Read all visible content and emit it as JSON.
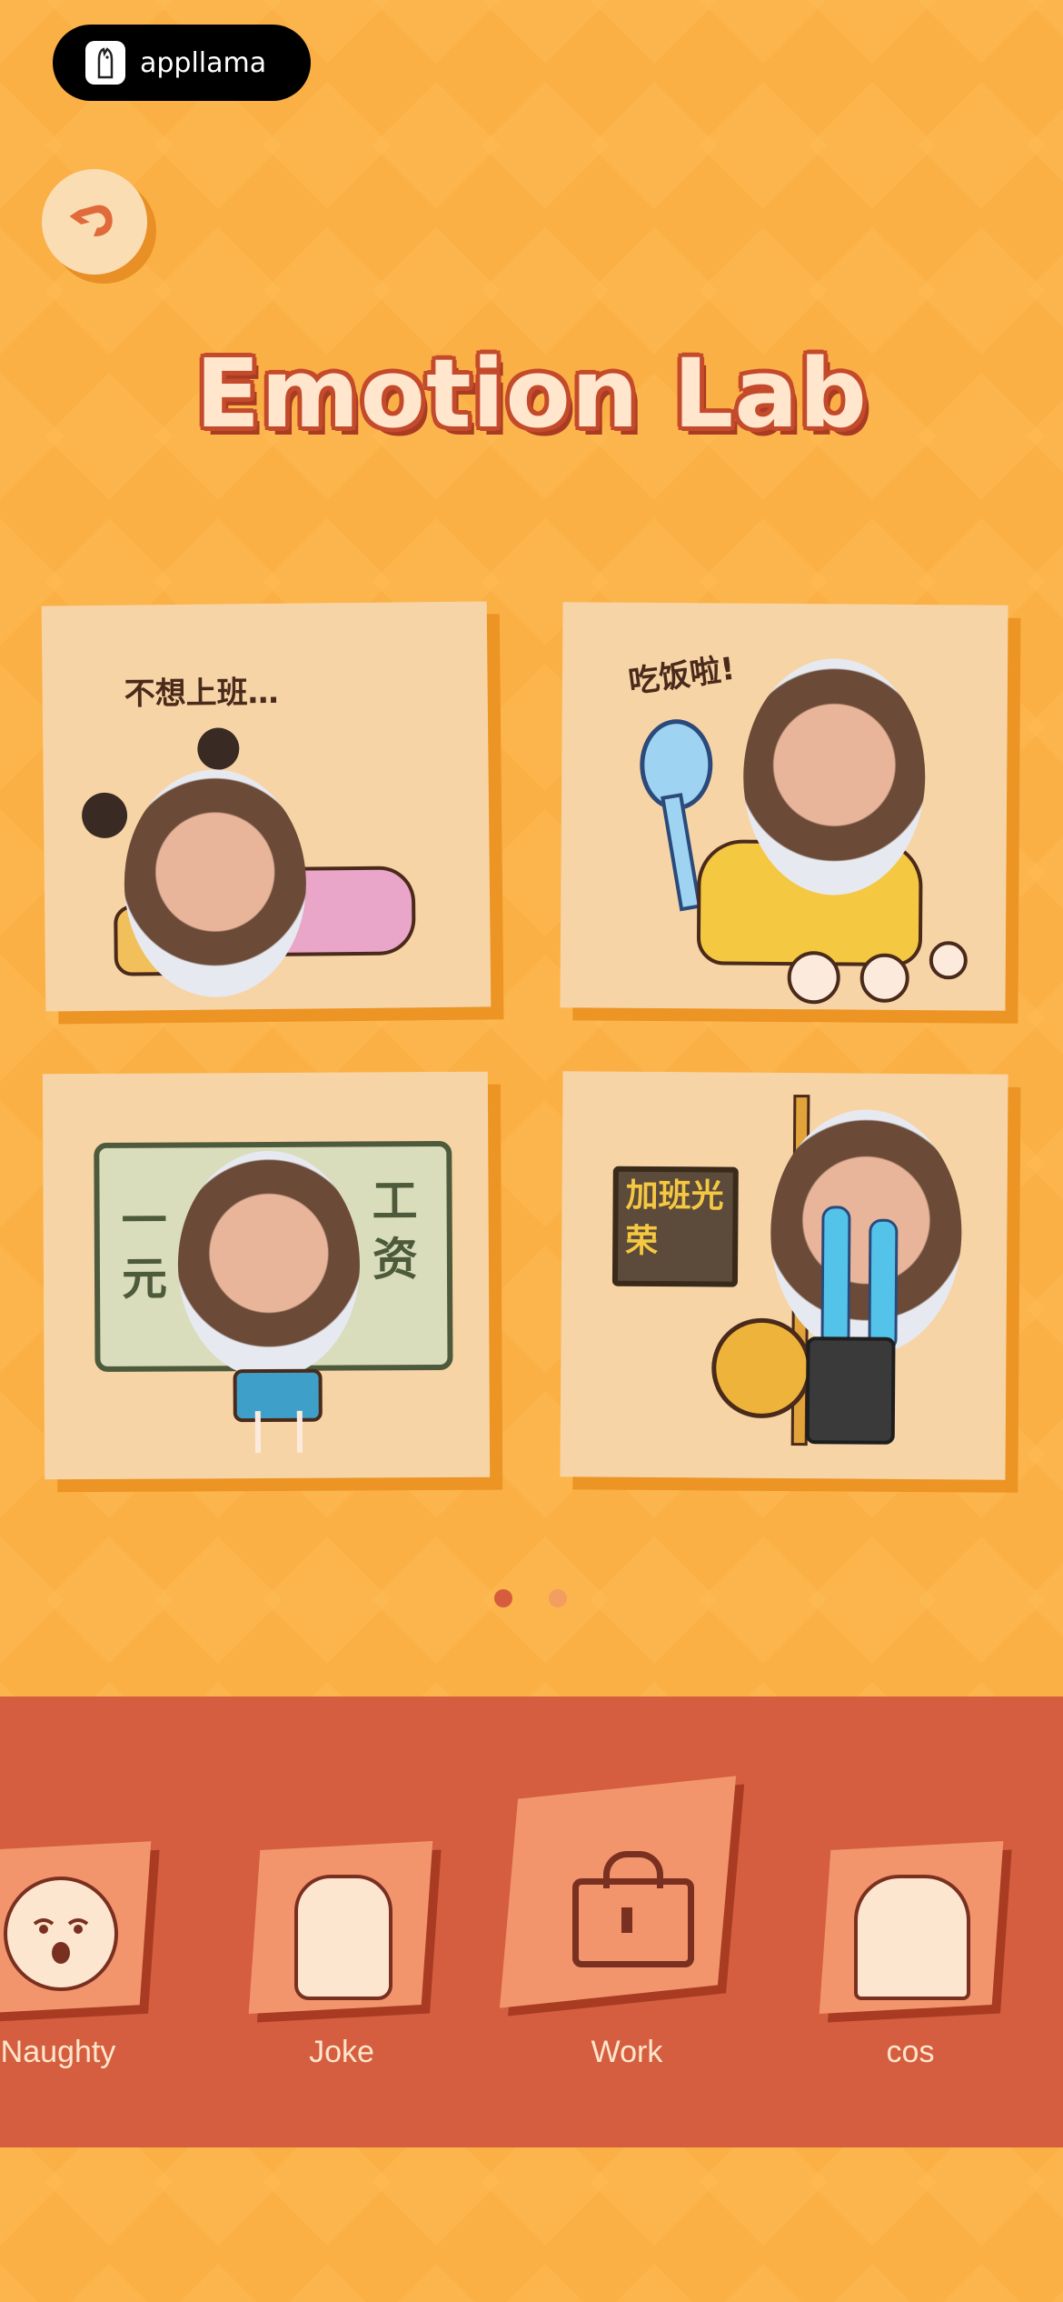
{
  "brand": {
    "name": "appllama"
  },
  "title": "Emotion Lab",
  "cards": [
    {
      "caption": "不想上班…"
    },
    {
      "caption": "吃饭啦!"
    },
    {
      "caption_left": "一元",
      "caption_right": "工资"
    },
    {
      "caption": "加班光荣"
    }
  ],
  "pagination": {
    "count": 2,
    "active": 0
  },
  "tabs": [
    {
      "label": "Naughty"
    },
    {
      "label": "Joke"
    },
    {
      "label": "Work"
    },
    {
      "label": "cos"
    }
  ],
  "colors": {
    "background": "#FBB045",
    "card": "#F7D4A6",
    "tabbar": "#D45E3F",
    "accent": "#C44A2C"
  }
}
